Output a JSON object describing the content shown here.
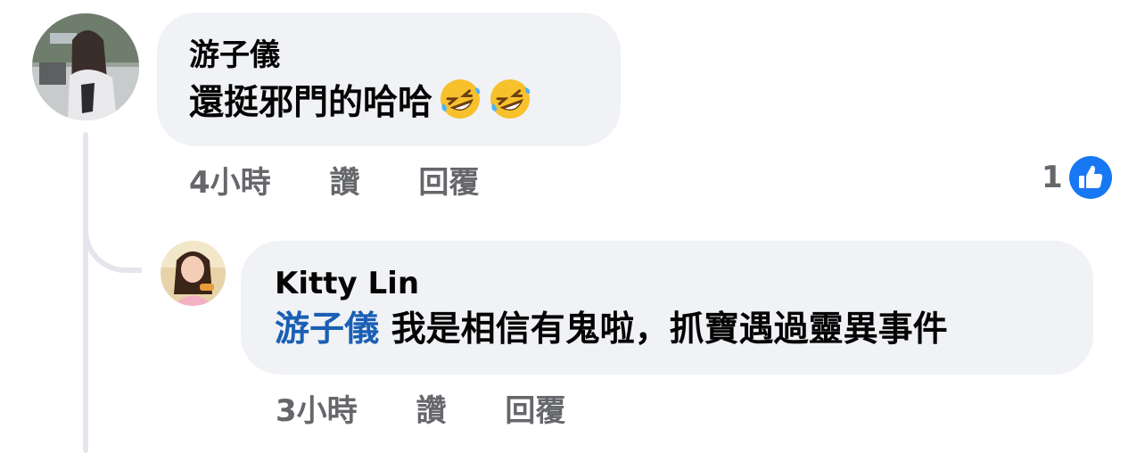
{
  "comment": {
    "author": "游子儀",
    "text": "還挺邪門的哈哈",
    "emojis": [
      "rolling-on-floor-laughing-emoji",
      "rolling-on-floor-laughing-emoji"
    ],
    "time": "4小時",
    "like_label": "讚",
    "reply_label": "回覆",
    "reaction_count": "1",
    "reaction_icon": "thumbs-up-icon",
    "reaction_color": "#1877f2"
  },
  "reply": {
    "author": "Kitty Lin",
    "mention": "游子儀",
    "text": " 我是相信有鬼啦，抓寶遇過靈異事件",
    "time": "3小時",
    "like_label": "讚",
    "reply_label": "回覆"
  },
  "colors": {
    "bubble": "#f0f2f5",
    "meta_text": "#65676b",
    "mention": "#1a5fb4",
    "thread_line": "#e4e6eb"
  }
}
